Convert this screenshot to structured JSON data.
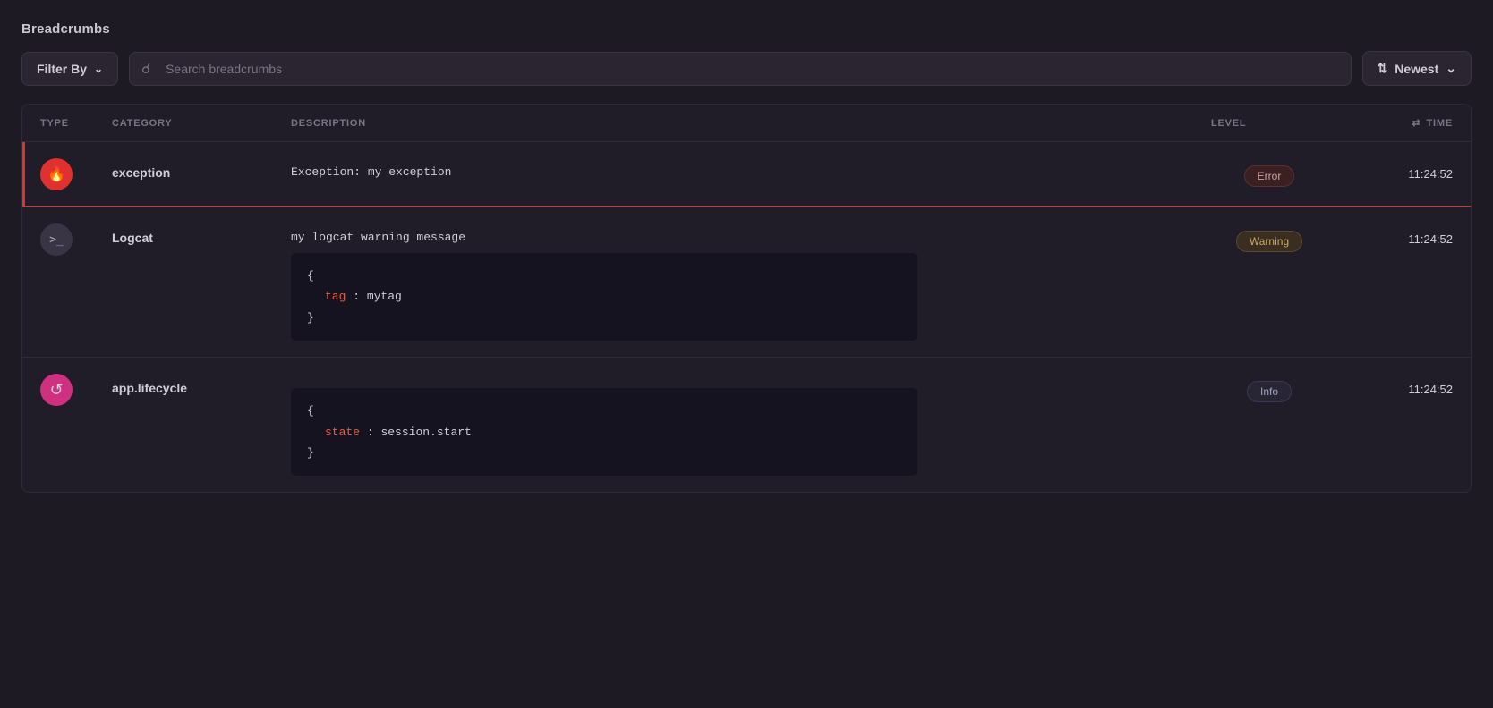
{
  "page": {
    "title": "Breadcrumbs"
  },
  "toolbar": {
    "filter_label": "Filter By",
    "search_placeholder": "Search breadcrumbs",
    "sort_label": "Newest",
    "sort_icon": "⇅"
  },
  "table": {
    "columns": [
      {
        "key": "type",
        "label": "TYPE"
      },
      {
        "key": "category",
        "label": "CATEGORY"
      },
      {
        "key": "description",
        "label": "DESCRIPTION"
      },
      {
        "key": "level",
        "label": "LEVEL"
      },
      {
        "key": "time",
        "label": "TIME",
        "has_sort": true
      }
    ],
    "rows": [
      {
        "id": "row-1",
        "type": "exception",
        "type_icon": "🔥",
        "icon_class": "exception",
        "category": "exception",
        "description_text": "Exception:  my exception",
        "has_code": false,
        "level": "Error",
        "level_class": "error",
        "time": "11:24:52",
        "is_error_row": true
      },
      {
        "id": "row-2",
        "type": "logcat",
        "type_icon": ">_",
        "icon_class": "logcat",
        "category": "Logcat",
        "description_text": "my logcat warning message",
        "has_code": true,
        "code": {
          "brace_open": "{",
          "key": "tag",
          "colon": ":  ",
          "value": "mytag",
          "brace_close": "}"
        },
        "level": "Warning",
        "level_class": "warning",
        "time": "11:24:52",
        "is_error_row": false
      },
      {
        "id": "row-3",
        "type": "lifecycle",
        "type_icon": "↺",
        "icon_class": "lifecycle",
        "category": "app.lifecycle",
        "description_text": "",
        "has_code": true,
        "code": {
          "brace_open": "{",
          "key": "state",
          "colon": ":  ",
          "value": "session.start",
          "brace_close": "}"
        },
        "level": "Info",
        "level_class": "info",
        "time": "11:24:52",
        "is_error_row": false
      }
    ]
  }
}
